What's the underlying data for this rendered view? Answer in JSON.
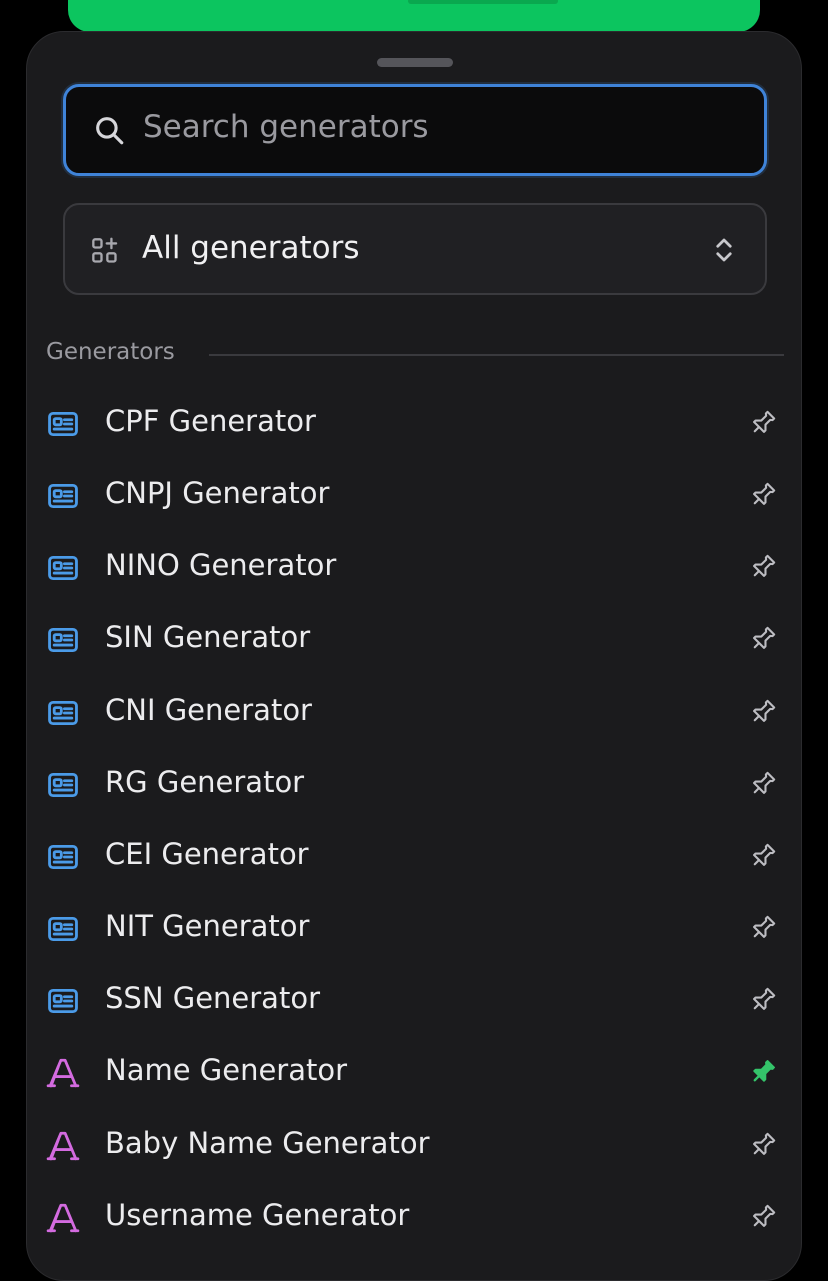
{
  "search": {
    "placeholder": "Search generators"
  },
  "category_select": {
    "label": "All generators"
  },
  "section": {
    "title": "Generators"
  },
  "colors": {
    "accent": "#3f83d8",
    "id_icon": "#4b9be8",
    "text_icon": "#d46be0",
    "pinned": "#34c46a"
  },
  "items": [
    {
      "label": "CPF Generator",
      "icon": "id-card-icon",
      "pinned": false
    },
    {
      "label": "CNPJ Generator",
      "icon": "id-card-icon",
      "pinned": false
    },
    {
      "label": "NINO Generator",
      "icon": "id-card-icon",
      "pinned": false
    },
    {
      "label": "SIN Generator",
      "icon": "id-card-icon",
      "pinned": false
    },
    {
      "label": "CNI Generator",
      "icon": "id-card-icon",
      "pinned": false
    },
    {
      "label": "RG Generator",
      "icon": "id-card-icon",
      "pinned": false
    },
    {
      "label": "CEI Generator",
      "icon": "id-card-icon",
      "pinned": false
    },
    {
      "label": "NIT Generator",
      "icon": "id-card-icon",
      "pinned": false
    },
    {
      "label": "SSN Generator",
      "icon": "id-card-icon",
      "pinned": false
    },
    {
      "label": "Name Generator",
      "icon": "letter-a-icon",
      "pinned": true
    },
    {
      "label": "Baby Name Generator",
      "icon": "letter-a-icon",
      "pinned": false
    },
    {
      "label": "Username Generator",
      "icon": "letter-a-icon",
      "pinned": false
    }
  ]
}
